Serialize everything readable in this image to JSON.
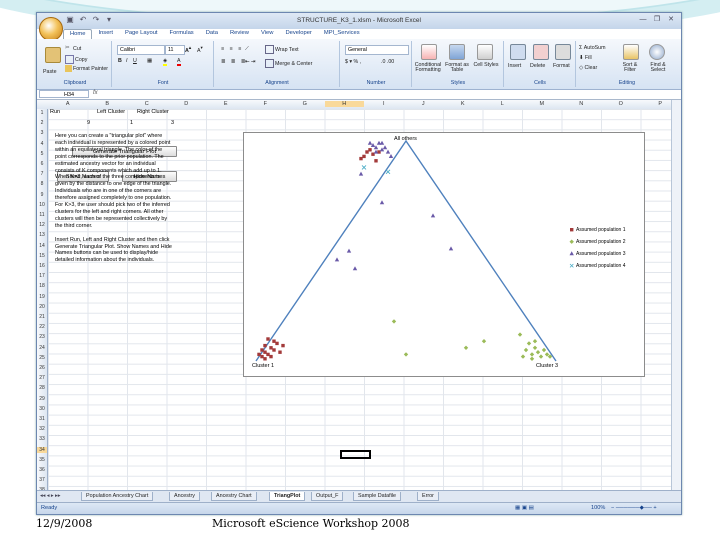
{
  "window": {
    "title": "STRUCTURE_K3_1.xlsm - Microsoft Excel",
    "tabs": [
      "Home",
      "Insert",
      "Page Layout",
      "Formulas",
      "Data",
      "Review",
      "View",
      "Developer",
      "MPI_Services"
    ],
    "active_tab": "Home"
  },
  "ribbon": {
    "clipboard": {
      "paste": "Paste",
      "cut": "Cut",
      "copy": "Copy",
      "format_painter": "Format Painter",
      "label": "Clipboard"
    },
    "font": {
      "name": "Calibri",
      "size": "11",
      "label": "Font"
    },
    "alignment": {
      "wrap": "Wrap Text",
      "merge": "Merge & Center",
      "label": "Alignment"
    },
    "number": {
      "format": "General",
      "label": "Number"
    },
    "styles": {
      "conditional": "Conditional Formatting",
      "format_table": "Format as Table",
      "cell_styles": "Cell Styles",
      "label": "Styles"
    },
    "cells": {
      "insert": "Insert",
      "delete": "Delete",
      "format": "Format",
      "label": "Cells"
    },
    "editing": {
      "autosum": "AutoSum",
      "fill": "Fill",
      "clear": "Clear",
      "sort": "Sort & Filter",
      "find": "Find & Select",
      "label": "Editing"
    }
  },
  "formula_bar": {
    "name_box": "H34",
    "fx": "fx"
  },
  "columns": [
    "A",
    "B",
    "C",
    "D",
    "E",
    "F",
    "G",
    "H",
    "I",
    "J",
    "K",
    "L",
    "M",
    "N",
    "O",
    "P",
    "Q",
    "R"
  ],
  "active_column": "H",
  "rows": [
    "1",
    "2",
    "3",
    "4",
    "5",
    "6",
    "7",
    "8",
    "9",
    "10",
    "11",
    "12",
    "13",
    "14",
    "15",
    "16",
    "17",
    "18",
    "19",
    "20",
    "21",
    "22",
    "23",
    "24",
    "25",
    "26",
    "27",
    "28",
    "29",
    "30",
    "31",
    "32",
    "33",
    "34",
    "35",
    "36",
    "37",
    "38"
  ],
  "active_row": "34",
  "cells": {
    "a1": "Run",
    "b1": "Left Cluster",
    "c1": "Right Cluster",
    "a2": "9",
    "b2": "1",
    "c2": "3"
  },
  "buttons": {
    "generate": "Generate Triangular Plot",
    "show": "Show Names",
    "hide": "Hide Names"
  },
  "info_text": [
    "Here you can create a \"triangular plot\" where",
    "each individual is represented by a colored point",
    "within an equilateral triangle. The color of the",
    "point corresponds to the prior population. The",
    "estimated ancestry vector for an individual",
    "consists of K components which add up to 1.",
    "When K=3, each of the three components is",
    "given by the distance to one edge of the triangle.",
    "Individuals who are in one of the corners are",
    "therefore assigned completely to one population.",
    "For K>3, the user should pick two of the inferred",
    "clusters for the left and right corners. All other",
    "clusters will then be represented collectively by",
    "the third corner.",
    "",
    "Insert Run, Left and Right Cluster and then click",
    "Generate Triangular Plot. Show Names and Hide",
    "Names buttons can be used to display/hide",
    "detailed information about the individuals."
  ],
  "chart_data": {
    "type": "scatter",
    "title": "",
    "corner_labels": {
      "top": "All others",
      "left": "Cluster 1",
      "right": "Cluster 3"
    },
    "legend_position": "right",
    "series": [
      {
        "name": "Assumed population 1",
        "color": "#a33a3a",
        "marker": "square",
        "points": [
          [
            0.02,
            0.02
          ],
          [
            0.03,
            0.04
          ],
          [
            0.04,
            0.03
          ],
          [
            0.05,
            0.06
          ],
          [
            0.06,
            0.05
          ],
          [
            0.03,
            0.07
          ],
          [
            0.07,
            0.08
          ],
          [
            0.02,
            0.05
          ],
          [
            0.08,
            0.04
          ],
          [
            0.05,
            0.02
          ],
          [
            0.06,
            0.09
          ],
          [
            0.04,
            0.1
          ],
          [
            0.03,
            0.01
          ],
          [
            0.09,
            0.07
          ],
          [
            0.01,
            0.03
          ],
          [
            0.35,
            0.92
          ],
          [
            0.37,
            0.95
          ],
          [
            0.38,
            0.96
          ],
          [
            0.36,
            0.93
          ],
          [
            0.39,
            0.94
          ],
          [
            0.4,
            0.91
          ],
          [
            0.41,
            0.95
          ]
        ]
      },
      {
        "name": "Assumed population 2",
        "color": "#9bbb59",
        "marker": "diamond",
        "points": [
          [
            0.9,
            0.05
          ],
          [
            0.92,
            0.03
          ],
          [
            0.93,
            0.06
          ],
          [
            0.94,
            0.04
          ],
          [
            0.95,
            0.02
          ],
          [
            0.91,
            0.08
          ],
          [
            0.96,
            0.05
          ],
          [
            0.92,
            0.01
          ],
          [
            0.97,
            0.03
          ],
          [
            0.89,
            0.02
          ],
          [
            0.93,
            0.09
          ],
          [
            0.98,
            0.02
          ],
          [
            0.76,
            0.09
          ],
          [
            0.88,
            0.12
          ],
          [
            0.5,
            0.03
          ],
          [
            0.7,
            0.06
          ],
          [
            0.46,
            0.18
          ]
        ]
      },
      {
        "name": "Assumed population 3",
        "color": "#6a5aa8",
        "marker": "triangle",
        "points": [
          [
            0.4,
            0.97
          ],
          [
            0.41,
            0.99
          ],
          [
            0.42,
            0.96
          ],
          [
            0.39,
            0.98
          ],
          [
            0.43,
            0.97
          ],
          [
            0.4,
            0.95
          ],
          [
            0.42,
            0.99
          ],
          [
            0.44,
            0.95
          ],
          [
            0.38,
            0.99
          ],
          [
            0.45,
            0.93
          ],
          [
            0.27,
            0.46
          ],
          [
            0.31,
            0.5
          ],
          [
            0.33,
            0.42
          ],
          [
            0.65,
            0.51
          ],
          [
            0.59,
            0.66
          ],
          [
            0.42,
            0.72
          ],
          [
            0.35,
            0.85
          ]
        ]
      },
      {
        "name": "Assumed population 4",
        "color": "#4bacc6",
        "marker": "x",
        "points": [
          [
            0.36,
            0.88
          ],
          [
            0.44,
            0.86
          ]
        ]
      }
    ]
  },
  "sheet_tabs": [
    "Population Ancestry Chart",
    "Ancestry",
    "Ancestry Chart",
    "TriangPlot",
    "Output_F",
    "Sample Datafile",
    "Error"
  ],
  "active_sheet": "TriangPlot",
  "status": {
    "ready": "Ready",
    "zoom": "100%"
  },
  "footer": {
    "date": "12/9/2008",
    "event": "Microsoft eScience Workshop 2008"
  },
  "colors": {
    "ribbon": "#d6e3f3",
    "accent": "#15428b",
    "triangle": "#4f81bd"
  }
}
